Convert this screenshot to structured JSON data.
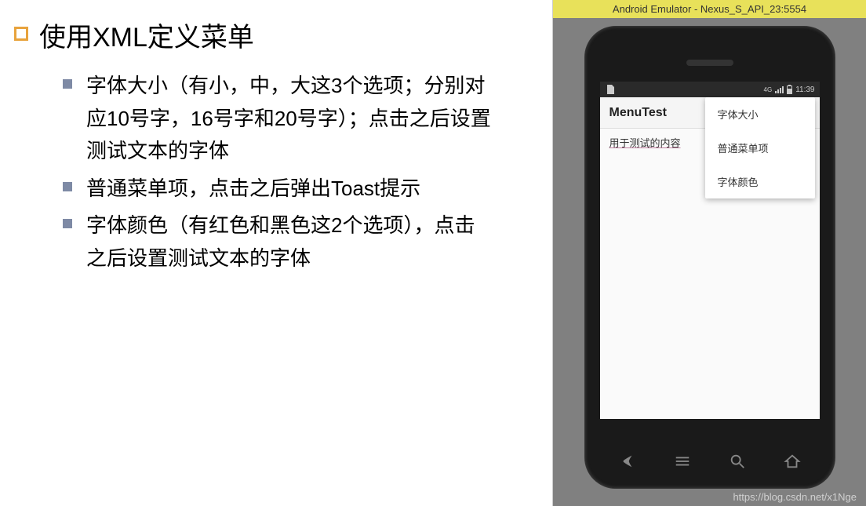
{
  "slide": {
    "title": "使用XML定义菜单",
    "bullets": [
      "字体大小（有小，中，大这3个选项；分别对应10号字，16号字和20号字）；点击之后设置测试文本的字体",
      "普通菜单项，点击之后弹出Toast提示",
      "字体颜色（有红色和黑色这2个选项），点击之后设置测试文本的字体"
    ]
  },
  "emulator": {
    "title": "Android Emulator - Nexus_S_API_23:5554",
    "status": {
      "net_label": "4G",
      "time": "11:39"
    },
    "app": {
      "toolbar_title": "MenuTest",
      "test_text": "用于测试的内容",
      "menu_items": [
        "字体大小",
        "普通菜单项",
        "字体颜色"
      ]
    }
  },
  "watermark": "https://blog.csdn.net/x1Nge"
}
